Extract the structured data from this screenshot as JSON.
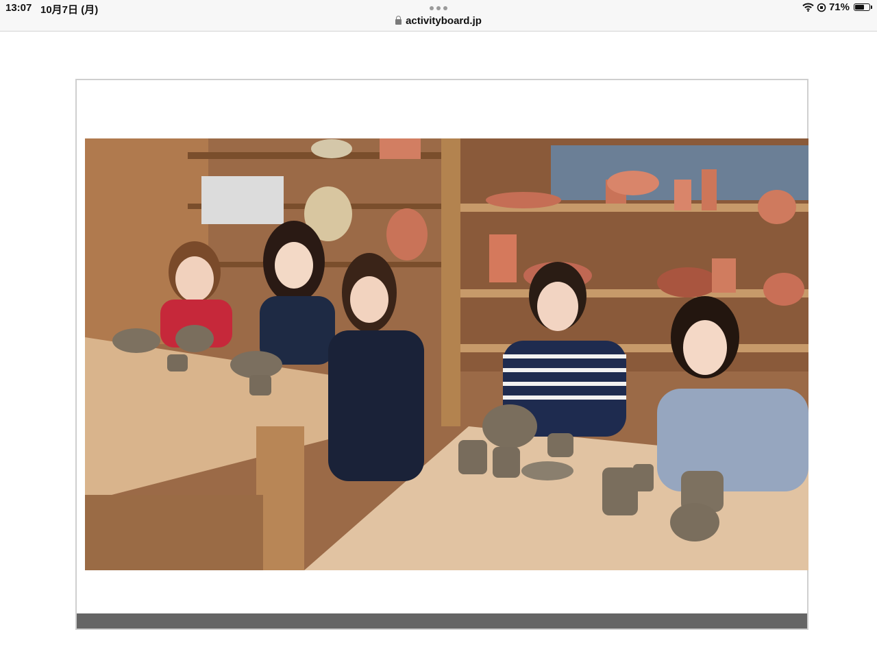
{
  "status_bar": {
    "time": "13:07",
    "date": "10月7日 (月)",
    "url": "activityboard.jp",
    "battery": "71%",
    "battery_level": 0.71
  },
  "photo": {
    "description_icon": "pottery-class-group-photo"
  },
  "colors": {
    "footer_bar": "#656565",
    "card_border": "#cfcfcf"
  }
}
